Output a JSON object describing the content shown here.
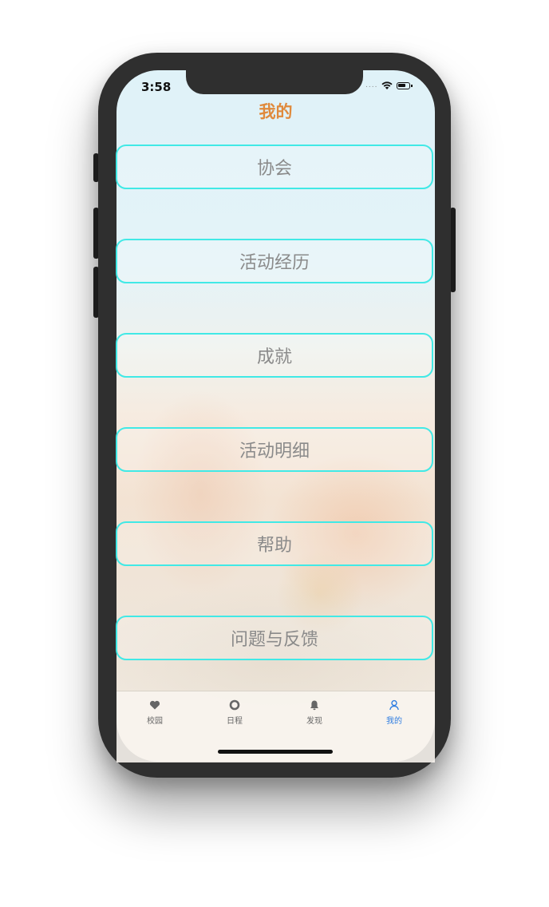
{
  "status_bar": {
    "time": "3:58",
    "signal_dots": "....",
    "icons": [
      "wifi-icon",
      "battery-icon"
    ]
  },
  "nav": {
    "title": "我的"
  },
  "menu": {
    "items": [
      {
        "label": "协会"
      },
      {
        "label": "活动经历"
      },
      {
        "label": "成就"
      },
      {
        "label": "活动明细"
      },
      {
        "label": "帮助"
      },
      {
        "label": "问题与反馈"
      }
    ]
  },
  "tabbar": {
    "tabs": [
      {
        "label": "校园",
        "icon": "heart-icon",
        "active": false
      },
      {
        "label": "日程",
        "icon": "circle-icon",
        "active": false
      },
      {
        "label": "发现",
        "icon": "bell-icon",
        "active": false
      },
      {
        "label": "我的",
        "icon": "person-icon",
        "active": true
      }
    ]
  },
  "colors": {
    "title": "#e08a3c",
    "button_border": "#41e9e6",
    "button_text": "#8a8a8a",
    "tab_active": "#2f7de1",
    "tab_inactive": "#666666"
  }
}
